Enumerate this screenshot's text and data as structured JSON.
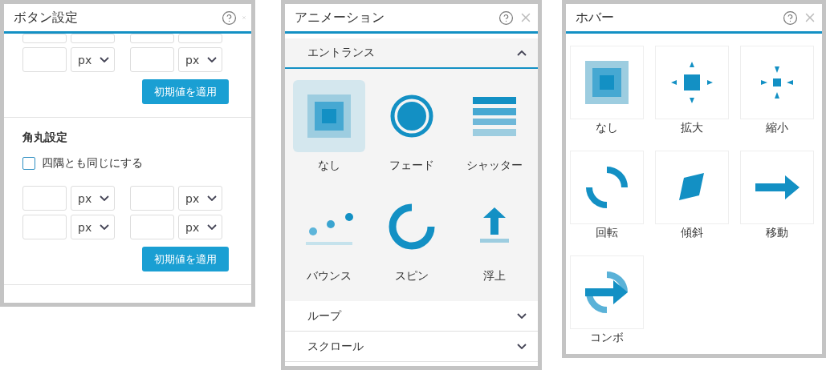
{
  "button_panel": {
    "title": "ボタン設定",
    "size_section": {
      "rows": [
        {
          "kind": "partial"
        },
        {
          "kind": "full",
          "units": [
            "px",
            "px"
          ]
        }
      ],
      "apply_label": "初期値を適用"
    },
    "radius_section": {
      "heading": "角丸設定",
      "checkbox": {
        "label": "四隅とも同じにする",
        "checked": false
      },
      "rows": [
        {
          "kind": "full",
          "units": [
            "px",
            "px"
          ]
        },
        {
          "kind": "full",
          "units": [
            "px",
            "px"
          ]
        }
      ],
      "apply_label": "初期値を適用"
    }
  },
  "animation_panel": {
    "title": "アニメーション",
    "groups": [
      {
        "label": "エントランス",
        "expanded": true,
        "items": [
          {
            "label": "なし",
            "kind": "squares",
            "selected": true
          },
          {
            "label": "フェード",
            "kind": "fade",
            "selected": false
          },
          {
            "label": "シャッター",
            "kind": "shutter",
            "selected": false
          },
          {
            "label": "バウンス",
            "kind": "bounce",
            "selected": false
          },
          {
            "label": "スピン",
            "kind": "spin",
            "selected": false
          },
          {
            "label": "浮上",
            "kind": "rise",
            "selected": false
          }
        ]
      },
      {
        "label": "ループ",
        "expanded": false
      },
      {
        "label": "スクロール",
        "expanded": false
      }
    ]
  },
  "hover_panel": {
    "title": "ホバー",
    "items": [
      {
        "label": "なし",
        "kind": "squares",
        "selected": false
      },
      {
        "label": "拡大",
        "kind": "grow",
        "selected": false
      },
      {
        "label": "縮小",
        "kind": "shrink",
        "selected": false
      },
      {
        "label": "回転",
        "kind": "rotate",
        "selected": false
      },
      {
        "label": "傾斜",
        "kind": "skew",
        "selected": false
      },
      {
        "label": "移動",
        "kind": "move",
        "selected": false
      },
      {
        "label": "コンボ",
        "kind": "combo",
        "selected": false
      }
    ]
  }
}
